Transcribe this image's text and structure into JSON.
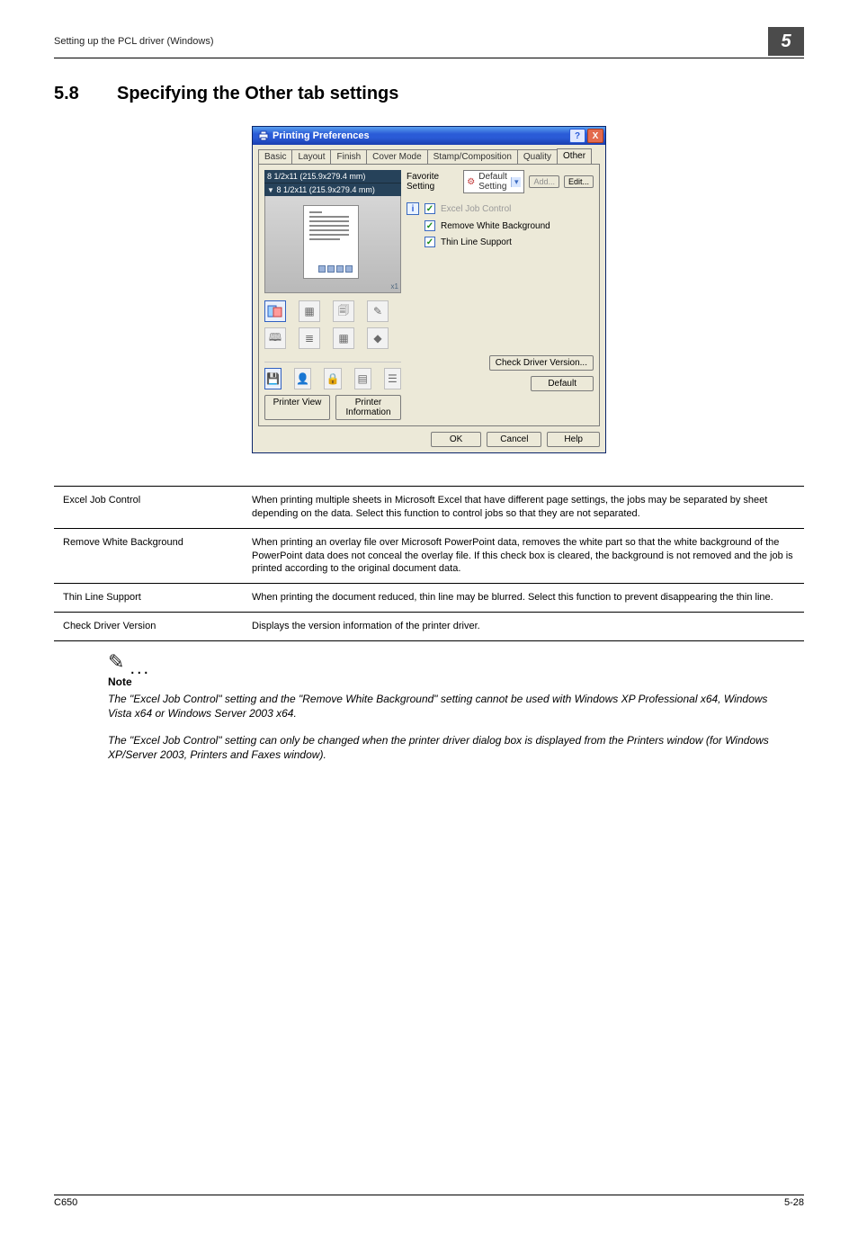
{
  "header": {
    "running_head": "Setting up the PCL driver (Windows)",
    "badge": "5"
  },
  "section": {
    "number": "5.8",
    "title": "Specifying the Other tab settings"
  },
  "dialog": {
    "window_title": "Printing Preferences",
    "tabs": [
      "Basic",
      "Layout",
      "Finish",
      "Cover Mode",
      "Stamp/Composition",
      "Quality",
      "Other"
    ],
    "active_tab_index": 6,
    "paper_label_top": "8 1/2x11 (215.9x279.4 mm)",
    "paper_label_bottom": "8 1/2x11 (215.9x279.4 mm)",
    "zoom_label": "x1",
    "favorite": {
      "label": "Favorite Setting",
      "selected": "Default Setting",
      "add_btn": "Add...",
      "edit_btn": "Edit..."
    },
    "options": {
      "excel_job_control": {
        "label": "Excel Job Control",
        "checked": true,
        "disabled": true
      },
      "remove_white_bg": {
        "label": "Remove White Background",
        "checked": true,
        "disabled": false
      },
      "thin_line_support": {
        "label": "Thin Line Support",
        "checked": true,
        "disabled": false
      }
    },
    "check_driver_version_btn": "Check Driver Version...",
    "printer_view_btn": "Printer View",
    "printer_info_btn": "Printer Information",
    "default_btn": "Default",
    "ok_btn": "OK",
    "cancel_btn": "Cancel",
    "help_btn": "Help",
    "title_help_btn": "?",
    "title_close_btn": "X"
  },
  "rows": [
    {
      "name": "Excel Job Control",
      "desc": "When printing multiple sheets in Microsoft Excel that have different page settings, the jobs may be separated by sheet depending on the data. Select this function to control jobs so that they are not separated."
    },
    {
      "name": "Remove White Background",
      "desc": "When printing an overlay file over Microsoft PowerPoint data, removes the white part so that the white background of the PowerPoint data does not conceal the overlay file. If this check box is cleared, the background is not removed and the job is printed according to the original document data."
    },
    {
      "name": "Thin Line Support",
      "desc": "When printing the document reduced, thin line may be blurred. Select this function to prevent disappearing the thin line."
    },
    {
      "name": "Check Driver Version",
      "desc": "Displays the version information of the printer driver."
    }
  ],
  "note": {
    "label": "Note",
    "p1": "The \"Excel Job Control\" setting and the \"Remove White Background\" setting cannot be used with Windows XP Professional x64, Windows Vista x64 or Windows Server 2003 x64.",
    "p2": "The \"Excel Job Control\" setting can only be changed when the printer driver dialog box is displayed from the Printers window (for Windows XP/Server 2003, Printers and Faxes window)."
  },
  "footer": {
    "left": "C650",
    "right": "5-28"
  }
}
